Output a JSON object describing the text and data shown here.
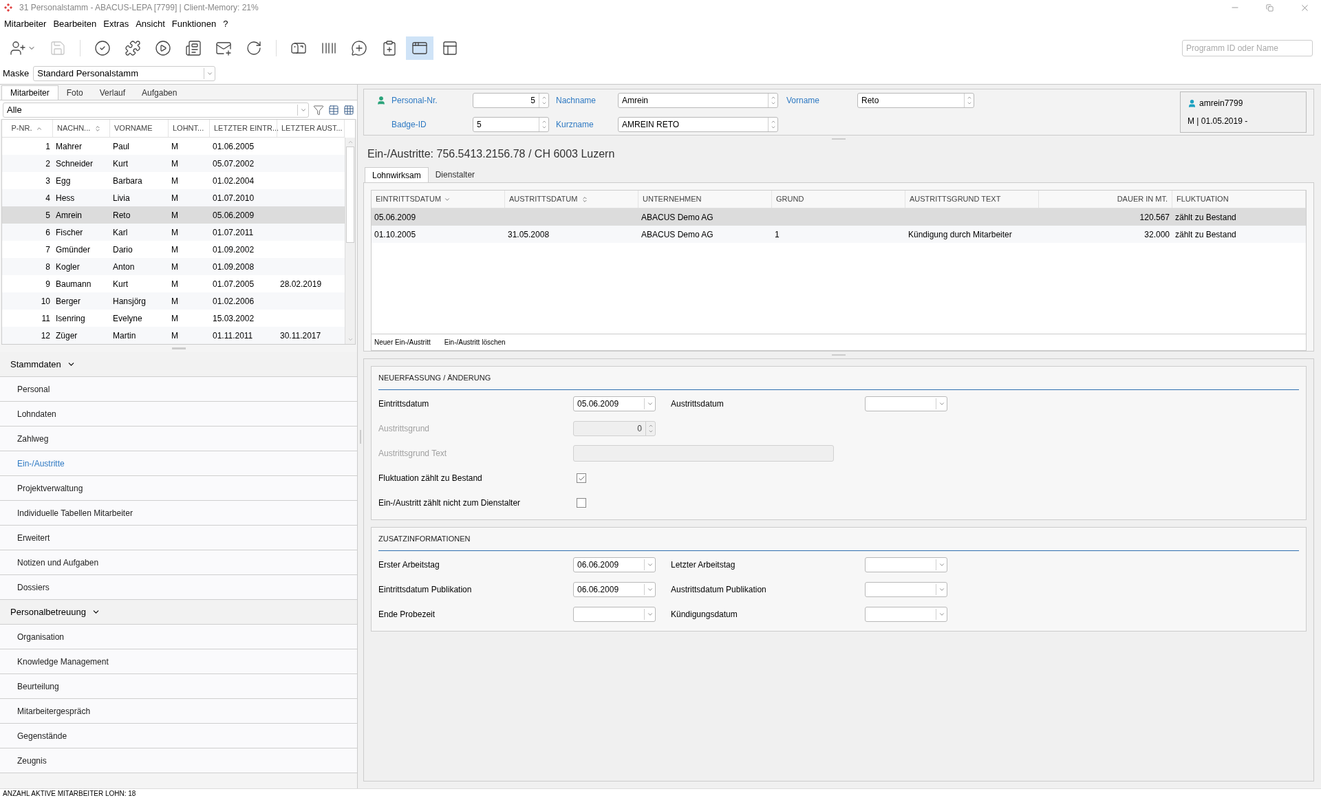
{
  "window": {
    "title": "31 Personalstamm - ABACUS-LEPA [7799] | Client-Memory: 21%"
  },
  "menu": [
    {
      "label": "Mitarbeiter"
    },
    {
      "label": "Bearbeiten"
    },
    {
      "label": "Extras"
    },
    {
      "label": "Ansicht"
    },
    {
      "label": "Funktionen"
    },
    {
      "label": "?"
    }
  ],
  "toolbar": [
    {
      "kind": "add-person",
      "disabled": false,
      "selected": false
    },
    {
      "kind": "save",
      "disabled": true,
      "selected": false
    },
    {
      "kind": "check",
      "disabled": false,
      "selected": false
    },
    {
      "kind": "puzzle",
      "disabled": false,
      "selected": false
    },
    {
      "kind": "play",
      "disabled": false,
      "selected": false
    },
    {
      "kind": "document",
      "disabled": false,
      "selected": false
    },
    {
      "kind": "mail-add",
      "disabled": false,
      "selected": false
    },
    {
      "kind": "refresh",
      "disabled": false,
      "selected": false
    },
    {
      "kind": "mailbox",
      "disabled": false,
      "selected": false
    },
    {
      "kind": "barcode",
      "disabled": false,
      "selected": false
    },
    {
      "kind": "comment-add",
      "disabled": false,
      "selected": false
    },
    {
      "kind": "clipboard-add",
      "disabled": false,
      "selected": false
    },
    {
      "kind": "windows",
      "disabled": false,
      "selected": true
    },
    {
      "kind": "layout",
      "disabled": false,
      "selected": false
    }
  ],
  "program_search": {
    "placeholder": "Programm ID oder Name"
  },
  "mask": {
    "label": "Maske",
    "value": "Standard Personalstamm"
  },
  "left_tabs": [
    {
      "label": "Mitarbeiter",
      "selected": true
    },
    {
      "label": "Foto",
      "selected": false
    },
    {
      "label": "Verlauf",
      "selected": false
    },
    {
      "label": "Aufgaben",
      "selected": false
    }
  ],
  "filter": {
    "value": "Alle"
  },
  "employee_table": {
    "columns": [
      {
        "label": "P-NR.",
        "sortable": true,
        "sorted": true,
        "ascending": true
      },
      {
        "label": "NACHN...",
        "sortable": true,
        "sorted": false
      },
      {
        "label": "VORNAME"
      },
      {
        "label": "LOHNT..."
      },
      {
        "label": "LETZTER EINTR..."
      },
      {
        "label": "LETZTER AUST..."
      }
    ],
    "rows": [
      {
        "nr": "1",
        "nachname": "Mahrer",
        "vorname": "Paul",
        "lohnt": "M",
        "eintritt": "01.06.2005",
        "selected": false
      },
      {
        "nr": "2",
        "nachname": "Schneider",
        "vorname": "Kurt",
        "lohnt": "M",
        "eintritt": "05.07.2002",
        "selected": false
      },
      {
        "nr": "3",
        "nachname": "Egg",
        "vorname": "Barbara",
        "lohnt": "M",
        "eintritt": "01.02.2004",
        "selected": false
      },
      {
        "nr": "4",
        "nachname": "Hess",
        "vorname": "Livia",
        "lohnt": "M",
        "eintritt": "01.07.2010",
        "selected": false
      },
      {
        "nr": "5",
        "nachname": "Amrein",
        "vorname": "Reto",
        "lohnt": "M",
        "eintritt": "05.06.2009",
        "selected": true
      },
      {
        "nr": "6",
        "nachname": "Fischer",
        "vorname": "Karl",
        "lohnt": "M",
        "eintritt": "01.07.2011",
        "selected": false
      },
      {
        "nr": "7",
        "nachname": "Gmünder",
        "vorname": "Dario",
        "lohnt": "M",
        "eintritt": "01.09.2002",
        "selected": false
      },
      {
        "nr": "8",
        "nachname": "Kogler",
        "vorname": "Anton",
        "lohnt": "M",
        "eintritt": "01.09.2008",
        "selected": false
      },
      {
        "nr": "9",
        "nachname": "Baumann",
        "vorname": "Kurt",
        "lohnt": "M",
        "eintritt": "01.07.2005",
        "austritt": "28.02.2019",
        "selected": false
      },
      {
        "nr": "10",
        "nachname": "Berger",
        "vorname": "Hansjörg",
        "lohnt": "M",
        "eintritt": "01.02.2006",
        "selected": false
      },
      {
        "nr": "11",
        "nachname": "Isenring",
        "vorname": "Evelyne",
        "lohnt": "M",
        "eintritt": "15.03.2002",
        "selected": false
      },
      {
        "nr": "12",
        "nachname": "Züger",
        "vorname": "Martin",
        "lohnt": "M",
        "eintritt": "01.11.2011",
        "austritt": "30.11.2017",
        "selected": false
      }
    ]
  },
  "nav": [
    {
      "label": "Stammdaten",
      "expanded": true,
      "children": [
        {
          "label": "Personal",
          "selected": false
        },
        {
          "label": "Lohndaten",
          "selected": false
        },
        {
          "label": "Zahlweg",
          "selected": false
        },
        {
          "label": "Ein-/Austritte",
          "selected": true
        },
        {
          "label": "Projektverwaltung",
          "selected": false
        },
        {
          "label": "Individuelle Tabellen Mitarbeiter",
          "selected": false
        },
        {
          "label": "Erweitert",
          "selected": false
        },
        {
          "label": "Notizen und Aufgaben",
          "selected": false
        },
        {
          "label": "Dossiers",
          "selected": false
        }
      ]
    },
    {
      "label": "Personalbetreuung",
      "expanded": true,
      "children": [
        {
          "label": "Organisation",
          "selected": false
        },
        {
          "label": "Knowledge Management",
          "selected": false
        },
        {
          "label": "Beurteilung",
          "selected": false
        },
        {
          "label": "Mitarbeitergespräch",
          "selected": false
        },
        {
          "label": "Gegenstände",
          "selected": false
        },
        {
          "label": "Zeugnis",
          "selected": false
        }
      ]
    }
  ],
  "header": {
    "personal_nr": {
      "label": "Personal-Nr.",
      "value": "5"
    },
    "nachname": {
      "label": "Nachname",
      "value": "Amrein"
    },
    "vorname": {
      "label": "Vorname",
      "value": "Reto"
    },
    "badge_id": {
      "label": "Badge-ID",
      "value": "5"
    },
    "kurzname": {
      "label": "Kurzname",
      "value": "AMREIN RETO"
    }
  },
  "user_card": {
    "user": "amrein7799",
    "info": "M | 01.05.2019 -"
  },
  "section_title": "Ein-/Austritte: 756.5413.2156.78 / CH 6003 Luzern",
  "detail_tabs": [
    {
      "label": "Lohnwirksam",
      "selected": true
    },
    {
      "label": "Dienstalter",
      "selected": false
    }
  ],
  "entries_table": {
    "columns": [
      {
        "label": "EINTRITTSDATUM",
        "sortable": true,
        "sorted": true,
        "ascending": false
      },
      {
        "label": "AUSTRITTSDATUM",
        "sortable": true,
        "sorted": false
      },
      {
        "label": "UNTERNEHMEN"
      },
      {
        "label": "GRUND"
      },
      {
        "label": "AUSTRITTSGRUND TEXT"
      },
      {
        "label": "DAUER IN MT."
      },
      {
        "label": "FLUKTUATION"
      }
    ],
    "rows": [
      {
        "eintritt": "05.06.2009",
        "unternehmen": "ABACUS Demo AG",
        "dauer": "120.567",
        "fluktuation": "zählt zu Bestand",
        "selected": true
      },
      {
        "eintritt": "01.10.2005",
        "austritt": "31.05.2008",
        "unternehmen": "ABACUS Demo AG",
        "grund": "1",
        "grund_text": "Kündigung durch Mitarbeiter",
        "dauer": "32.000",
        "fluktuation": "zählt zu Bestand",
        "selected": false
      }
    ],
    "actions": [
      {
        "label": "Neuer Ein-/Austritt"
      },
      {
        "label": "Ein-/Austritt löschen"
      }
    ]
  },
  "sections": [
    {
      "title": "NEUERFASSUNG / ÄNDERUNG",
      "rows": [
        {
          "kind": "date-pair",
          "left": {
            "label": "Eintrittsdatum",
            "value": "05.06.2009"
          },
          "right": {
            "label": "Austrittsdatum"
          }
        },
        {
          "kind": "number",
          "label": "Austrittsgrund",
          "value": "0",
          "disabled": true
        },
        {
          "kind": "text",
          "label": "Austrittsgrund Text",
          "disabled": true
        },
        {
          "kind": "checkbox",
          "label": "Fluktuation zählt zu Bestand",
          "checked": true
        },
        {
          "kind": "checkbox",
          "label": "Ein-/Austritt zählt nicht zum Dienstalter",
          "checked": false
        }
      ]
    },
    {
      "title": "ZUSATZINFORMATIONEN",
      "rows": [
        {
          "kind": "date-pair",
          "left": {
            "label": "Erster Arbeitstag",
            "value": "06.06.2009"
          },
          "right": {
            "label": "Letzter Arbeitstag"
          }
        },
        {
          "kind": "date-pair",
          "left": {
            "label": "Eintrittsdatum Publikation",
            "value": "06.06.2009"
          },
          "right": {
            "label": "Austrittsdatum Publikation"
          }
        },
        {
          "kind": "date-pair",
          "left": {
            "label": "Ende Probezeit"
          },
          "right": {
            "label": "Kündigungsdatum"
          }
        }
      ]
    }
  ],
  "status_bar": {
    "text": "ANZAHL AKTIVE MITARBEITER LOHN: 18"
  }
}
